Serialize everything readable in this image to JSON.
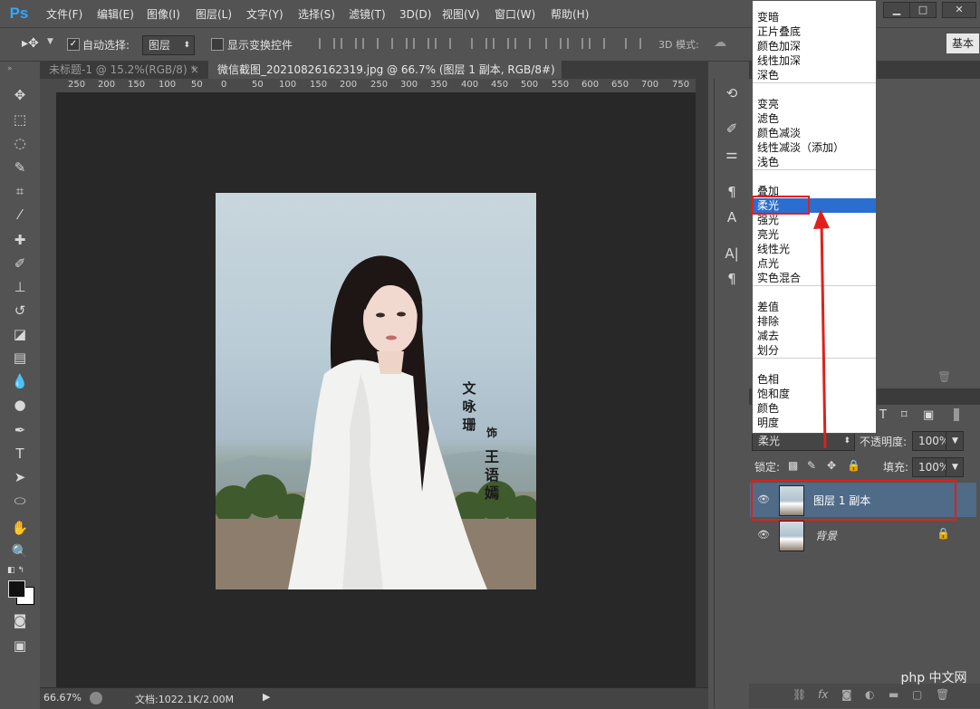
{
  "menubar": {
    "items": [
      "文件(F)",
      "编辑(E)",
      "图像(I)",
      "图层(L)",
      "文字(Y)",
      "选择(S)",
      "滤镜(T)",
      "3D(D)",
      "视图(V)",
      "窗口(W)",
      "帮助(H)"
    ]
  },
  "options": {
    "auto_select_label": "自动选择:",
    "auto_select_value": "图层",
    "show_transform_label": "显示变换控件",
    "mode_3d_label": "3D 模式:",
    "workspace_label": "基本"
  },
  "tabs": [
    {
      "label": "未标题-1 @ 15.2%(RGB/8) *",
      "close": "×",
      "active": false
    },
    {
      "label": "微信截图_20210826162319.jpg @ 66.7% (图层 1 副本, RGB/8#) *",
      "close": "×",
      "active": true
    }
  ],
  "ruler": {
    "labels": [
      "250",
      "200",
      "150",
      "100",
      "50",
      "0",
      "50",
      "100",
      "150",
      "200",
      "250",
      "300",
      "350",
      "400",
      "450",
      "500",
      "550",
      "600",
      "650",
      "700",
      "750"
    ]
  },
  "photo": {
    "vertical_text_1": "文咏珊",
    "vertical_text_2": "饰",
    "vertical_text_3": "王语嫣"
  },
  "status": {
    "zoom": "66.67%",
    "doc_info": "文档:1022.1K/2.00M"
  },
  "blend_groups": [
    [
      "变暗",
      "正片叠底",
      "颜色加深",
      "线性加深",
      "深色"
    ],
    [
      "变亮",
      "滤色",
      "颜色减淡",
      "线性减淡（添加）",
      "浅色"
    ],
    [
      "叠加",
      "柔光",
      "强光",
      "亮光",
      "线性光",
      "点光",
      "实色混合"
    ],
    [
      "差值",
      "排除",
      "减去",
      "划分"
    ],
    [
      "色相",
      "饱和度",
      "颜色",
      "明度"
    ]
  ],
  "blend_selected": "柔光",
  "layers_panel": {
    "blend_mode_value": "柔光",
    "opacity_label": "不透明度:",
    "opacity_value": "100%",
    "lock_label": "锁定:",
    "fill_label": "填充:",
    "fill_value": "100%",
    "layers": [
      {
        "name": "图层 1 副本",
        "selected": true,
        "locked": false
      },
      {
        "name": "背景",
        "selected": false,
        "locked": true
      }
    ]
  },
  "watermark": "php 中文网",
  "colors": {
    "highlight": "#2a6fd0",
    "annotation_red": "#e0201c",
    "ps_blue": "#31a8ff"
  }
}
